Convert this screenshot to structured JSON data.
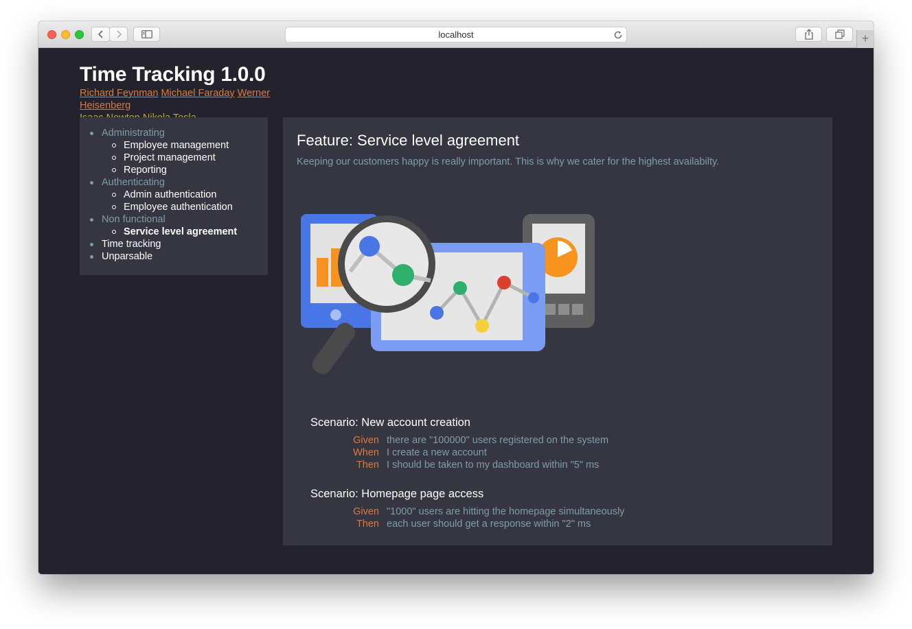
{
  "browser": {
    "url": "localhost"
  },
  "site": {
    "title": "Time Tracking 1.0.0",
    "authors": [
      {
        "name": "Richard Feynman",
        "color": "#dd7a3a"
      },
      {
        "name": "Michael Faraday",
        "color": "#dd7a3a"
      },
      {
        "name": "Werner Heisenberg",
        "color": "#dd7a3a"
      },
      {
        "name": "Isaac Newton",
        "color": "#b6ac36"
      },
      {
        "name": "Nikola Tesla",
        "color": "#b6ac36"
      }
    ]
  },
  "nav": {
    "sections": [
      {
        "label": "Administrating",
        "items": [
          "Employee management",
          "Project management",
          "Reporting"
        ]
      },
      {
        "label": "Authenticating",
        "items": [
          "Admin authentication",
          "Employee authentication"
        ]
      },
      {
        "label": "Non functional",
        "items": [
          "Service level agreement"
        ],
        "active_item": "Service level agreement"
      },
      {
        "label": "Time tracking"
      },
      {
        "label": "Unparsable"
      }
    ]
  },
  "feature": {
    "title": "Feature: Service level agreement",
    "description": "Keeping our customers happy is really important. This is why we cater for the highest availabilty.",
    "scenarios": [
      {
        "title": "Scenario: New account creation",
        "steps": [
          {
            "keyword": "Given",
            "text": "there are \"100000\" users registered on the system"
          },
          {
            "keyword": "When",
            "text": "I create a new account"
          },
          {
            "keyword": "Then",
            "text": "I should be taken to my dashboard within \"5\" ms"
          }
        ]
      },
      {
        "title": "Scenario: Homepage page access",
        "steps": [
          {
            "keyword": "Given",
            "text": "\"1000\" users are hitting the homepage simultaneously"
          },
          {
            "keyword": "Then",
            "text": "each user should get a response within \"2\" ms"
          }
        ]
      }
    ]
  },
  "colors": {
    "background": "#23222d",
    "panel": "#363542",
    "accent_orange": "#dd7a3a",
    "accent_olive": "#b6ac36",
    "muted_text": "#7d9ea7"
  }
}
